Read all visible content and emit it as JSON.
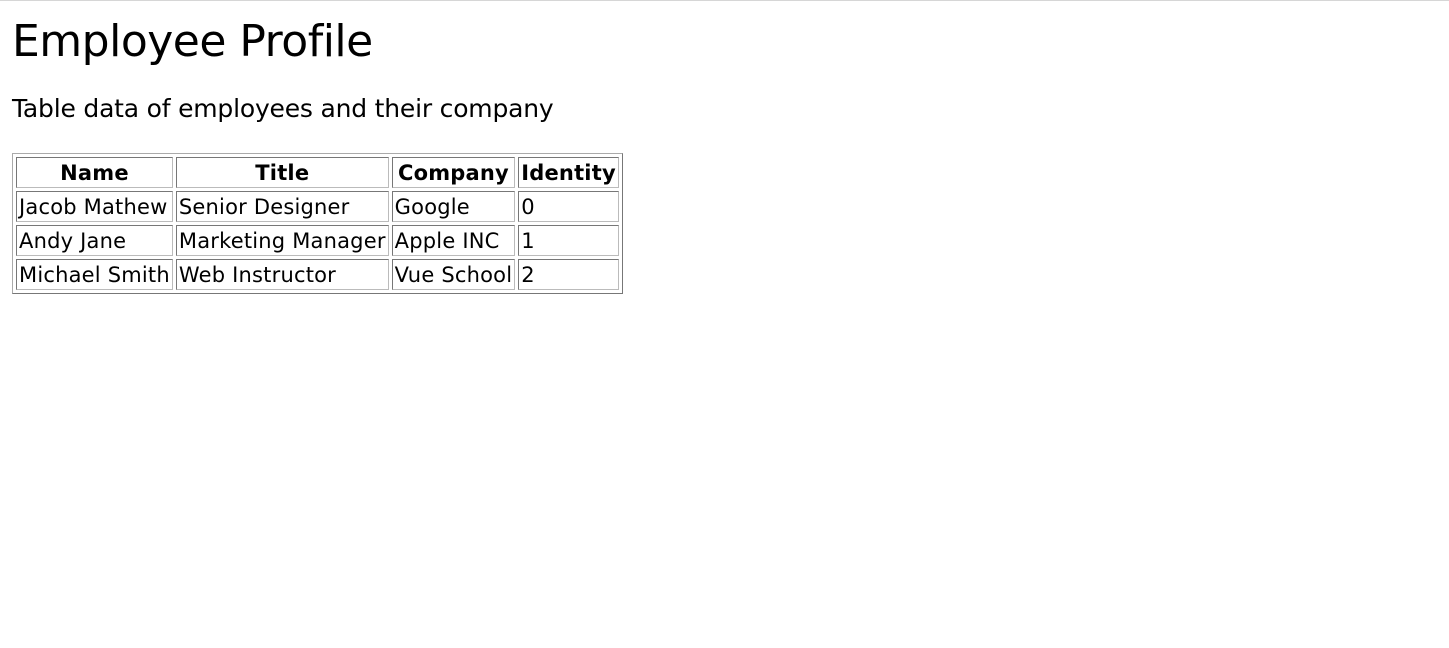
{
  "page": {
    "title": "Employee Profile",
    "subtitle": "Table data of employees and their company"
  },
  "table": {
    "headers": [
      "Name",
      "Title",
      "Company",
      "Identity"
    ],
    "rows": [
      {
        "name": "Jacob Mathew",
        "title": "Senior Designer",
        "company": "Google",
        "identity": "0"
      },
      {
        "name": "Andy Jane",
        "title": "Marketing Manager",
        "company": "Apple INC",
        "identity": "1"
      },
      {
        "name": "Michael Smith",
        "title": "Web Instructor",
        "company": "Vue School",
        "identity": "2"
      }
    ]
  }
}
